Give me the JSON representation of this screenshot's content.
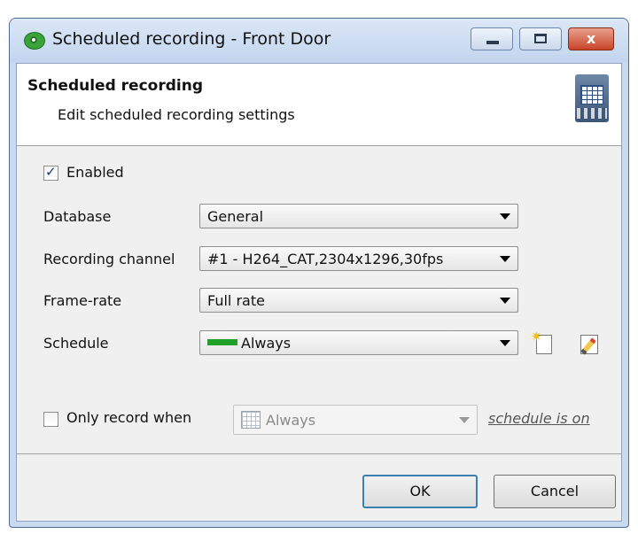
{
  "window": {
    "title": "Scheduled recording - Front Door",
    "controls": {
      "close_glyph": "x"
    }
  },
  "header": {
    "title": "Scheduled recording",
    "subtitle": "Edit scheduled recording settings",
    "icon": "calendar-film-icon"
  },
  "form": {
    "enabled_label": "Enabled",
    "enabled_checked": true,
    "database_label": "Database",
    "database_value": "General",
    "channel_label": "Recording channel",
    "channel_value": "#1 - H264_CAT,2304x1296,30fps",
    "framerate_label": "Frame-rate",
    "framerate_value": "Full rate",
    "schedule_label": "Schedule",
    "schedule_value": "Always",
    "schedule_swatch_color": "#22a12a",
    "only_record_label": "Only record when",
    "only_record_checked": false,
    "only_record_value": "Always",
    "only_record_suffix": "schedule is on"
  },
  "buttons": {
    "ok": "OK",
    "cancel": "Cancel"
  }
}
